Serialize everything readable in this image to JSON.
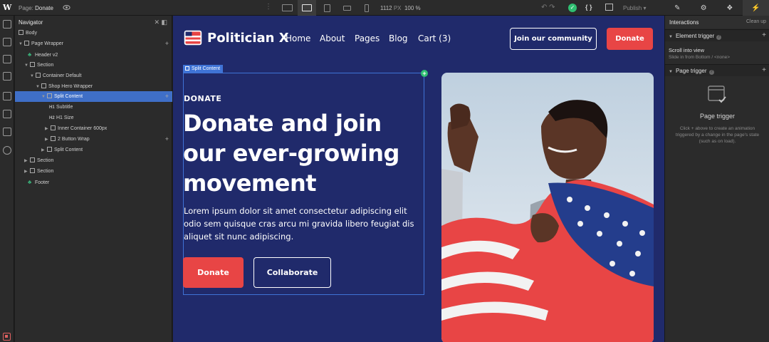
{
  "topbar": {
    "logo": "W",
    "page_prefix": "Page:",
    "page_name": "Donate",
    "width_value": "1112",
    "width_unit": "PX",
    "zoom": "100 %",
    "publish_label": "Publish",
    "undo_symbol": "↶ ↷",
    "code_symbol": "{ }",
    "right_tabs": [
      "✎",
      "⚙",
      "❖",
      "⚡"
    ]
  },
  "navigator": {
    "title": "Navigator",
    "tree": [
      {
        "label": "Body"
      },
      {
        "label": "Page Wrapper"
      },
      {
        "label": "Header v2"
      },
      {
        "label": "Section"
      },
      {
        "label": "Container Default"
      },
      {
        "label": "Shop Hero Wrapper"
      },
      {
        "label": "Split Content"
      },
      {
        "label": "Subtitle",
        "tag": "H1"
      },
      {
        "label": "H1 Size",
        "tag": "H2"
      },
      {
        "label": "Inner Container 600px"
      },
      {
        "label": "2 Button Wrap"
      },
      {
        "label": "Split Content"
      },
      {
        "label": "Section"
      },
      {
        "label": "Section"
      },
      {
        "label": "Footer"
      }
    ]
  },
  "site": {
    "brand": "Politician X",
    "nav": [
      "Home",
      "About",
      "Pages",
      "Blog",
      "Cart (3)"
    ],
    "community_button": "Join our community",
    "donate_top_button": "Donate",
    "selection_tag": "Split Content",
    "subtitle": "DONATE",
    "heading": "Donate and join our ever-growing movement",
    "paragraph": "Lorem ipsum dolor sit amet consectetur adipiscing elit odio sem quisque cras arcu mi gravida libero feugiat dis aliquet sit nunc adipiscing.",
    "donate_button": "Donate",
    "collaborate_button": "Collaborate",
    "colors": {
      "background": "#202a6b",
      "accent": "#e84545"
    }
  },
  "interactions": {
    "title": "Interactions",
    "clean_up": "Clean up",
    "element_trigger": "Element trigger",
    "scroll_title": "Scroll into view",
    "scroll_sub": "Slide in from Bottom / <none>",
    "page_trigger": "Page trigger",
    "page_trigger_heading": "Page trigger",
    "page_trigger_desc": "Click + above to create an animation triggered by a change in the page's state (such as on load)."
  }
}
